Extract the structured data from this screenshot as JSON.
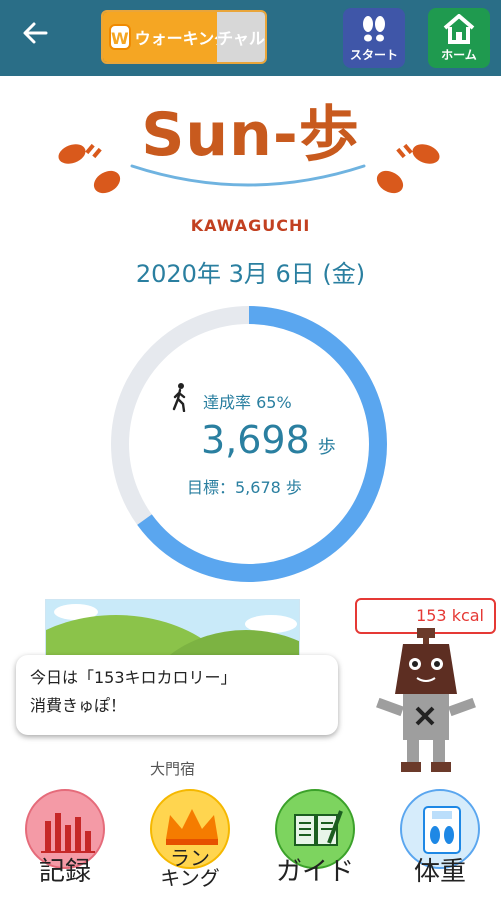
{
  "topbar": {
    "back_icon": "back-arrow-icon",
    "channel_left": "ウォーキング",
    "channel_right": "チャル",
    "channel_logo": "W",
    "start_label": "スタート",
    "home_label": "ホーム"
  },
  "logo": {
    "title": "Sun-歩",
    "city": "KAWAGUCHI"
  },
  "date": "2020年 3月 6日 (金)",
  "progress": {
    "rate_text": "達成率 65%",
    "rate_fraction": 0.65,
    "steps": "3,698",
    "steps_unit": "歩",
    "goal_text": "目標：5,678 歩"
  },
  "kcal": "153 kcal",
  "message": {
    "line1": "今日は「153キロカロリー」",
    "line2": "消費きゅぽ！"
  },
  "station": "大門宿",
  "buttons": {
    "record": "記録",
    "ranking_line1": "ラン",
    "ranking_line2": "キング",
    "guide": "ガイド",
    "weight": "体重"
  },
  "colors": {
    "topbar": "#2a6e87",
    "accent_blue": "#5aa6ef",
    "ring_bg": "#e6e9ee",
    "brand_orange": "#c85a1e"
  }
}
